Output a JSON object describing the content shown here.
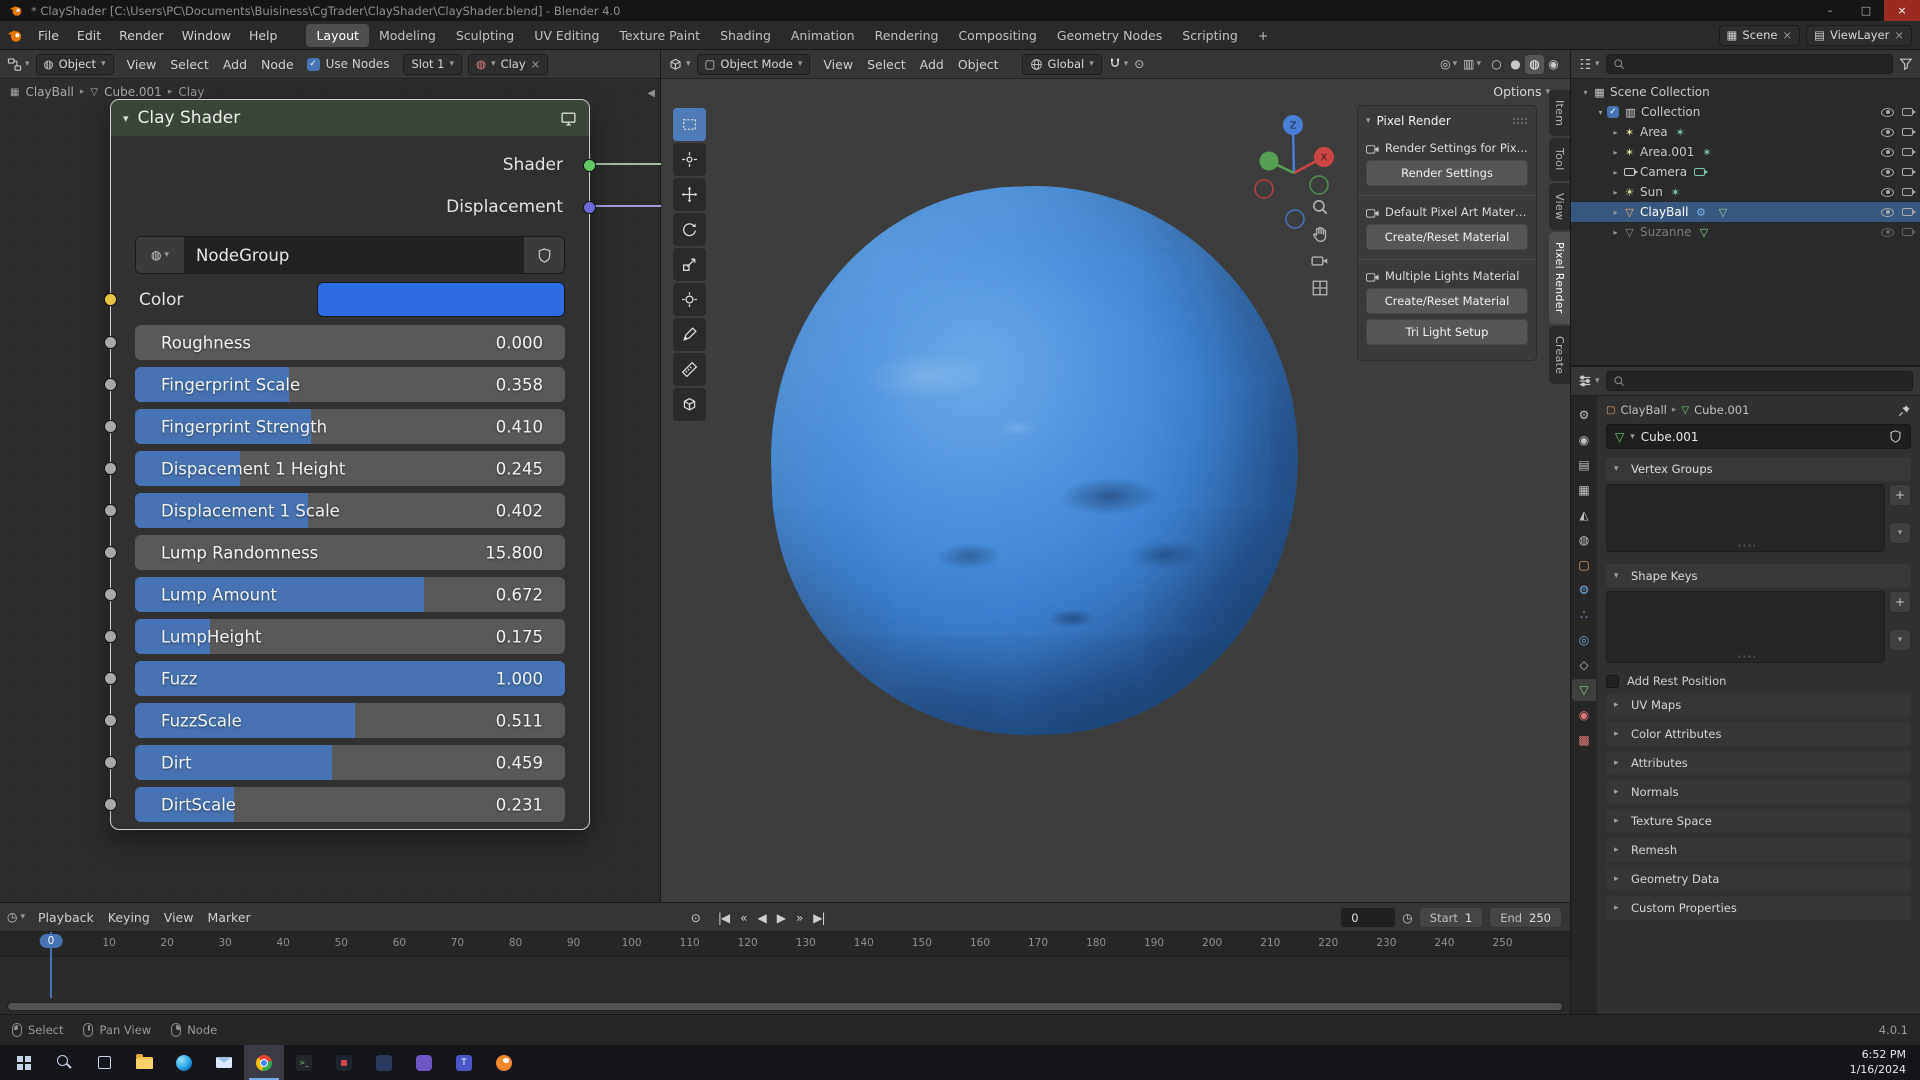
{
  "colors": {
    "accent": "#4772b3",
    "node_header_green": "#3a4637",
    "object_blue": "#3f87d9",
    "selection_row": "#39587f"
  },
  "window": {
    "title": "* ClayShader [C:\\Users\\PC\\Documents\\Buisiness\\CgTrader\\ClayShader\\ClayShader.blend] - Blender 4.0"
  },
  "topbar": {
    "menus": [
      "File",
      "Edit",
      "Render",
      "Window",
      "Help"
    ],
    "workspaces": [
      "Layout",
      "Modeling",
      "Sculpting",
      "UV Editing",
      "Texture Paint",
      "Shading",
      "Animation",
      "Rendering",
      "Compositing",
      "Geometry Nodes",
      "Scripting"
    ],
    "active_workspace": "Layout",
    "add_tab": "+",
    "scene": "Scene",
    "view_layer": "ViewLayer"
  },
  "shader_editor": {
    "header": {
      "shader_type": "Object",
      "menus": [
        "View",
        "Select",
        "Add",
        "Node"
      ],
      "use_nodes": "Use Nodes",
      "use_nodes_checked": true,
      "slot": "Slot 1",
      "material": "Clay"
    },
    "breadcrumb": [
      "ClayBall",
      "Cube.001",
      "Clay"
    ],
    "node": {
      "title": "Clay Shader",
      "outputs": [
        {
          "label": "Shader",
          "socket_color": "#63c763",
          "wire_color": "#9fbf9f"
        },
        {
          "label": "Displacement",
          "socket_color": "#6b6bd7",
          "wire_color": "#a5a0dd"
        }
      ],
      "group_field": "NodeGroup",
      "color_label": "Color",
      "color_value": "#2e6be4",
      "color_socket": "#e6c545",
      "sliders": [
        {
          "label": "Roughness",
          "value": "0.000",
          "fill": 0
        },
        {
          "label": "Fingerprint Scale",
          "value": "0.358",
          "fill": 0.358
        },
        {
          "label": "Fingerprint Strength",
          "value": "0.410",
          "fill": 0.41
        },
        {
          "label": "Dispacement 1 Height",
          "value": "0.245",
          "fill": 0.245
        },
        {
          "label": "Displacement 1 Scale",
          "value": "0.402",
          "fill": 0.402
        },
        {
          "label": "Lump Randomness",
          "value": "15.800",
          "fill": 0
        },
        {
          "label": "Lump Amount",
          "value": "0.672",
          "fill": 0.672
        },
        {
          "label": "LumpHeight",
          "value": "0.175",
          "fill": 0.175
        },
        {
          "label": "Fuzz",
          "value": "1.000",
          "fill": 1
        },
        {
          "label": "FuzzScale",
          "value": "0.511",
          "fill": 0.511
        },
        {
          "label": "Dirt",
          "value": "0.459",
          "fill": 0.459
        },
        {
          "label": "DirtScale",
          "value": "0.231",
          "fill": 0.231
        }
      ]
    }
  },
  "viewport": {
    "header": {
      "mode": "Object Mode",
      "menus": [
        "View",
        "Select",
        "Add",
        "Object"
      ],
      "orientation": "Global"
    },
    "options": "Options",
    "tools": [
      "box-select",
      "cursor",
      "move",
      "rotate",
      "scale",
      "transform",
      "annotate",
      "measure",
      "add-cube"
    ],
    "active_tool": "box-select",
    "gizmo_labels": {
      "x": "X",
      "z": "Z"
    },
    "nav": [
      "zoom",
      "pan",
      "camera-view",
      "grid-ortho"
    ]
  },
  "npanel": {
    "title": "Pixel Render",
    "groups": [
      {
        "heading": "Render Settings for Pix...",
        "buttons": [
          "Render Settings"
        ]
      },
      {
        "heading": "Default Pixel Art Material",
        "buttons": [
          "Create/Reset Material"
        ]
      },
      {
        "heading": "Multiple Lights Material",
        "buttons": [
          "Create/Reset Material",
          "Tri Light Setup"
        ]
      }
    ],
    "tabs": [
      "Item",
      "Tool",
      "View",
      "Pixel Render",
      "Create"
    ],
    "active_tab": "Pixel Render"
  },
  "outliner": {
    "rows": [
      {
        "label": "Scene Collection",
        "depth": 0,
        "icon": "scene-collection",
        "disclosure": "▾",
        "toggles": false
      },
      {
        "label": "Collection",
        "depth": 1,
        "icon": "collection",
        "disclosure": "▾",
        "checkbox": true,
        "toggles": true
      },
      {
        "label": "Area",
        "depth": 2,
        "icon": "light-area",
        "disclosure": "▸",
        "extras": [
          "light-data"
        ],
        "toggles": true
      },
      {
        "label": "Area.001",
        "depth": 2,
        "icon": "light-area",
        "disclosure": "▸",
        "extras": [
          "light-data"
        ],
        "toggles": true
      },
      {
        "label": "Camera",
        "depth": 2,
        "icon": "camera",
        "disclosure": "▸",
        "extras": [
          "camera-data"
        ],
        "toggles": true
      },
      {
        "label": "Sun",
        "depth": 2,
        "icon": "light-sun",
        "disclosure": "▸",
        "extras": [
          "light-data"
        ],
        "toggles": true
      },
      {
        "label": "ClayBall",
        "depth": 2,
        "icon": "mesh",
        "disclosure": "▸",
        "extras": [
          "modifier",
          "mesh-data"
        ],
        "selected": true,
        "toggles": true
      },
      {
        "label": "Suzanne",
        "depth": 2,
        "icon": "mesh",
        "disclosure": "▸",
        "extras": [
          "mesh-data"
        ],
        "dimmed": true,
        "toggles": true
      }
    ]
  },
  "properties": {
    "breadcrumb": [
      "ClayBall",
      "Cube.001"
    ],
    "name_field": "Cube.001",
    "tabs": [
      "tool",
      "render",
      "output",
      "view-layer",
      "scene",
      "world",
      "object",
      "modifiers",
      "particles",
      "physics",
      "constraints",
      "object-data",
      "material",
      "texture"
    ],
    "active_tab": "object-data",
    "panels_open": [
      {
        "label": "Vertex Groups"
      },
      {
        "label": "Shape Keys"
      }
    ],
    "checkbox": "Add Rest Position",
    "panels_closed": [
      "UV Maps",
      "Color Attributes",
      "Attributes",
      "Normals",
      "Texture Space",
      "Remesh",
      "Geometry Data",
      "Custom Properties"
    ]
  },
  "timeline": {
    "menus": [
      "Playback",
      "Keying",
      "View",
      "Marker"
    ],
    "transport": [
      "jump-start",
      "prev-key",
      "play-reverse",
      "play",
      "next-key",
      "jump-end"
    ],
    "frame": "0",
    "start_label": "Start",
    "start": "1",
    "end_label": "End",
    "end": "250",
    "ticks": [
      0,
      10,
      20,
      30,
      40,
      50,
      60,
      70,
      80,
      90,
      100,
      110,
      120,
      130,
      140,
      150,
      160,
      170,
      180,
      190,
      200,
      210,
      220,
      230,
      240,
      250
    ],
    "playhead": 0
  },
  "statusbar": {
    "hints": [
      {
        "icon": "mouse-left",
        "label": "Select"
      },
      {
        "icon": "mouse-middle",
        "label": "Pan View"
      },
      {
        "icon": "mouse-right",
        "label": "Node"
      }
    ],
    "version": "4.0.1"
  },
  "taskbar": {
    "icons": [
      "start",
      "search",
      "task-view",
      "file-explorer",
      "edge",
      "mail",
      "chrome",
      "app-1",
      "app-2",
      "app-3",
      "app-4",
      "app-5",
      "blender"
    ],
    "active_icon": "chrome",
    "time": "6:52 PM",
    "date": "1/16/2024"
  }
}
